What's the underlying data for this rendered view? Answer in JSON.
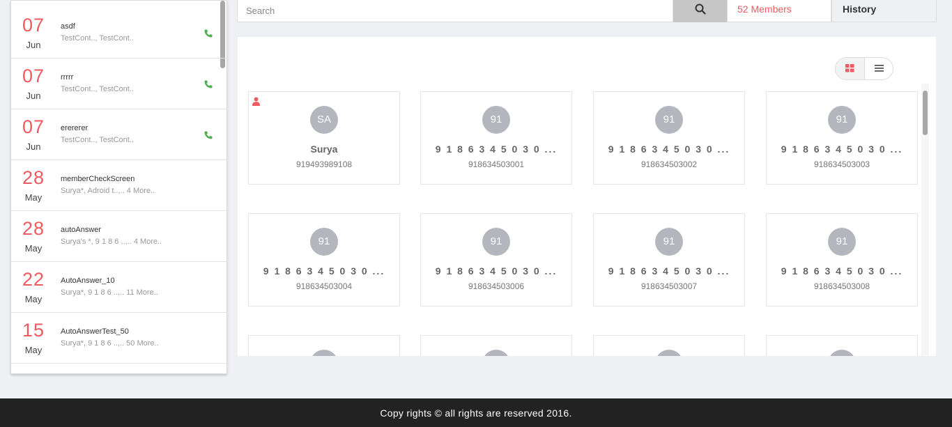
{
  "search": {
    "placeholder": "Search",
    "icon": "search-icon"
  },
  "tabs": {
    "members": "52 Members",
    "history": "History"
  },
  "colors": {
    "accent": "#ee5a5f",
    "phone": "#4caf50",
    "avatar": "#b3b7bd",
    "footer_bg": "#222222"
  },
  "calls": [
    {
      "day": "07",
      "month": "Jun",
      "name": "asdf",
      "participants": "TestCont.., TestCont..",
      "icon": "phone-icon"
    },
    {
      "day": "07",
      "month": "Jun",
      "name": "rrrrr",
      "participants": "TestCont.., TestCont..",
      "icon": "phone-icon"
    },
    {
      "day": "07",
      "month": "Jun",
      "name": "erererer",
      "participants": "TestCont.., TestCont..",
      "icon": "phone-icon"
    },
    {
      "day": "28",
      "month": "May",
      "name": "memberCheckScreen",
      "participants": "Surya*, Adroid t..,.. 4 More..",
      "icon": ""
    },
    {
      "day": "28",
      "month": "May",
      "name": "autoAnswer",
      "participants": "Surya's *, 9 1 8 6 ..,.. 4 More..",
      "icon": ""
    },
    {
      "day": "22",
      "month": "May",
      "name": "AutoAnswer_10",
      "participants": "Surya*, 9 1 8 6 ..,.. 11 More..",
      "icon": ""
    },
    {
      "day": "15",
      "month": "May",
      "name": "AutoAnswerTest_50",
      "participants": "Surya*, 9 1 8 6 ..,.. 50 More..",
      "icon": ""
    }
  ],
  "members": [
    {
      "initials": "SA",
      "name": "Surya",
      "number": "919493989108",
      "owner": true
    },
    {
      "initials": "91",
      "name": "9 1 8 6 3 4 5 0 3 0 ...",
      "number": "918634503001",
      "owner": false
    },
    {
      "initials": "91",
      "name": "9 1 8 6 3 4 5 0 3 0 ...",
      "number": "918634503002",
      "owner": false
    },
    {
      "initials": "91",
      "name": "9 1 8 6 3 4 5 0 3 0 ...",
      "number": "918634503003",
      "owner": false
    },
    {
      "initials": "91",
      "name": "9 1 8 6 3 4 5 0 3 0 ...",
      "number": "918634503004",
      "owner": false
    },
    {
      "initials": "91",
      "name": "9 1 8 6 3 4 5 0 3 0 ...",
      "number": "918634503006",
      "owner": false
    },
    {
      "initials": "91",
      "name": "9 1 8 6 3 4 5 0 3 0 ...",
      "number": "918634503007",
      "owner": false
    },
    {
      "initials": "91",
      "name": "9 1 8 6 3 4 5 0 3 0 ...",
      "number": "918634503008",
      "owner": false
    },
    {
      "initials": "",
      "name": "",
      "number": "",
      "owner": false
    },
    {
      "initials": "",
      "name": "",
      "number": "",
      "owner": false
    },
    {
      "initials": "",
      "name": "",
      "number": "",
      "owner": false
    },
    {
      "initials": "",
      "name": "",
      "number": "",
      "owner": false
    }
  ],
  "view_modes": {
    "grid_icon": "grid-view-icon",
    "list_icon": "list-view-icon"
  },
  "footer": {
    "text": "Copy rights © all rights are reserved 2016."
  }
}
